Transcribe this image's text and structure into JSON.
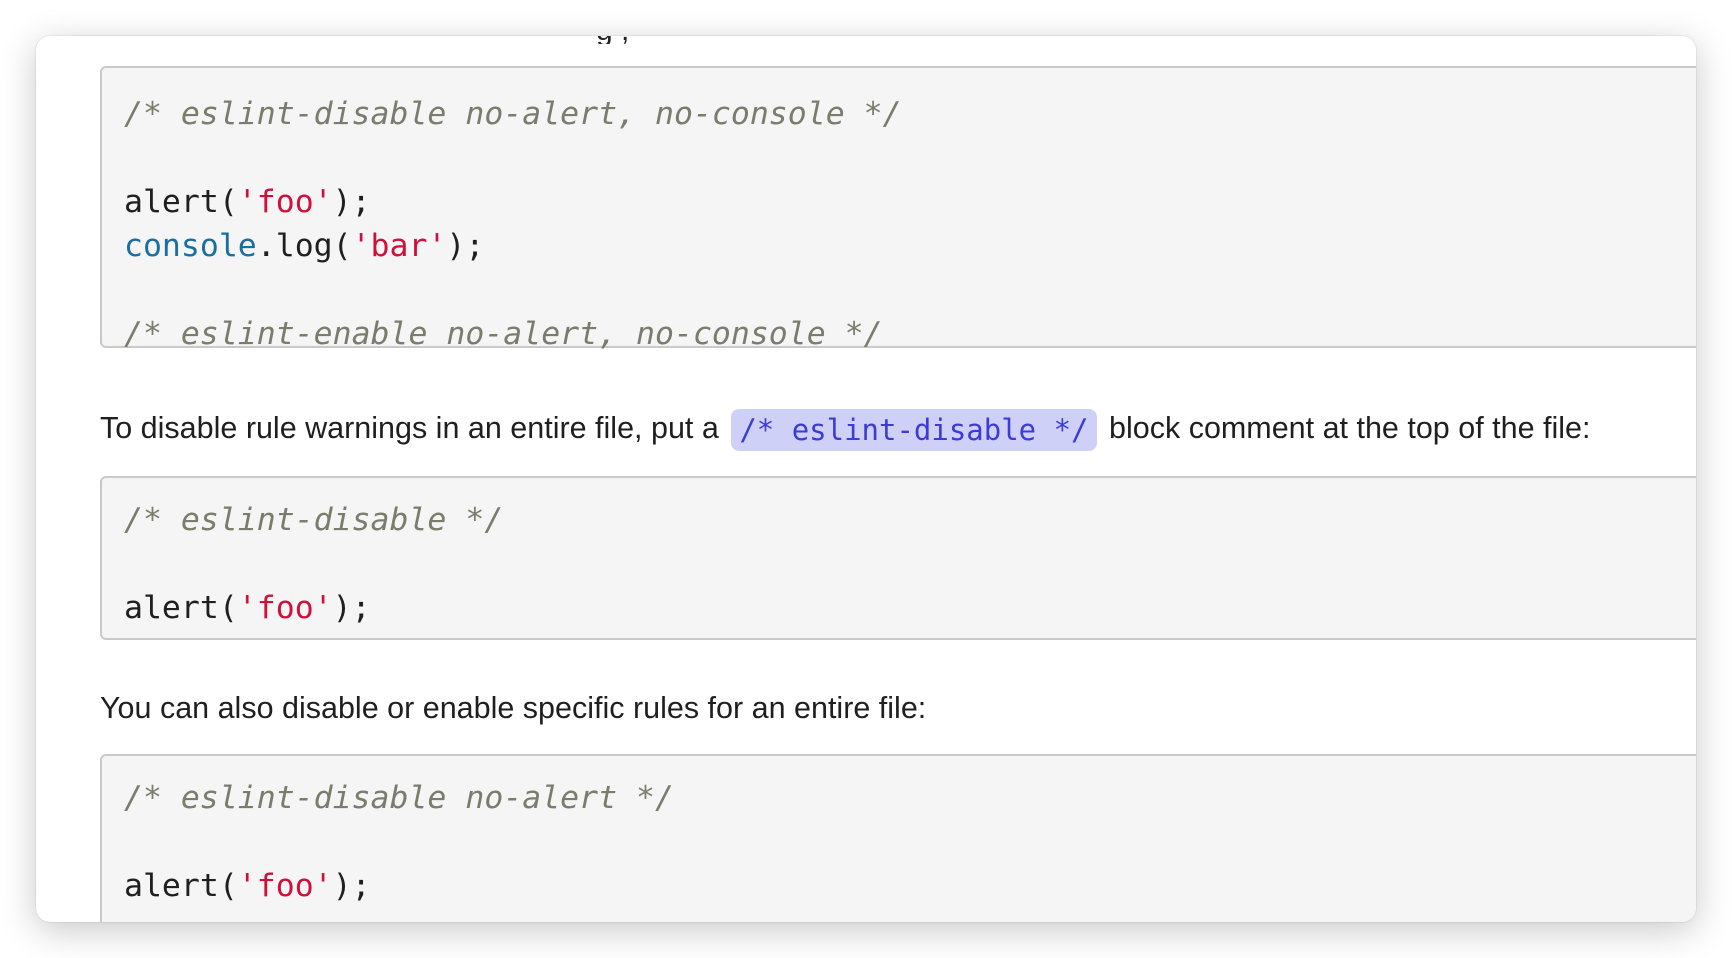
{
  "top_clipped_text": "g   ,",
  "code_block_1": {
    "lines": [
      [
        {
          "t": "/* eslint-disable no-alert, no-console */",
          "k": "comment"
        }
      ],
      [],
      [
        {
          "t": "alert(",
          "k": "plain"
        },
        {
          "t": "'foo'",
          "k": "string"
        },
        {
          "t": ");",
          "k": "plain"
        }
      ],
      [
        {
          "t": "console",
          "k": "builtin"
        },
        {
          "t": ".log(",
          "k": "plain"
        },
        {
          "t": "'bar'",
          "k": "string"
        },
        {
          "t": ");",
          "k": "plain"
        }
      ],
      [],
      [
        {
          "t": "/* eslint-enable no-alert, no-console */",
          "k": "comment"
        }
      ]
    ]
  },
  "paragraph_1": {
    "before": "To disable rule warnings in an entire file, put a",
    "code": "/* eslint-disable */",
    "after": "block comment at the top of the file:"
  },
  "code_block_2": {
    "lines": [
      [
        {
          "t": "/* eslint-disable */",
          "k": "comment"
        }
      ],
      [],
      [
        {
          "t": "alert(",
          "k": "plain"
        },
        {
          "t": "'foo'",
          "k": "string"
        },
        {
          "t": ");",
          "k": "plain"
        }
      ]
    ]
  },
  "paragraph_2": {
    "text": "You can also disable or enable specific rules for an entire file:"
  },
  "code_block_3": {
    "lines": [
      [
        {
          "t": "/* eslint-disable no-alert */",
          "k": "comment"
        }
      ],
      [],
      [
        {
          "t": "alert(",
          "k": "plain"
        },
        {
          "t": "'foo'",
          "k": "string"
        },
        {
          "t": ");",
          "k": "plain"
        }
      ]
    ]
  }
}
